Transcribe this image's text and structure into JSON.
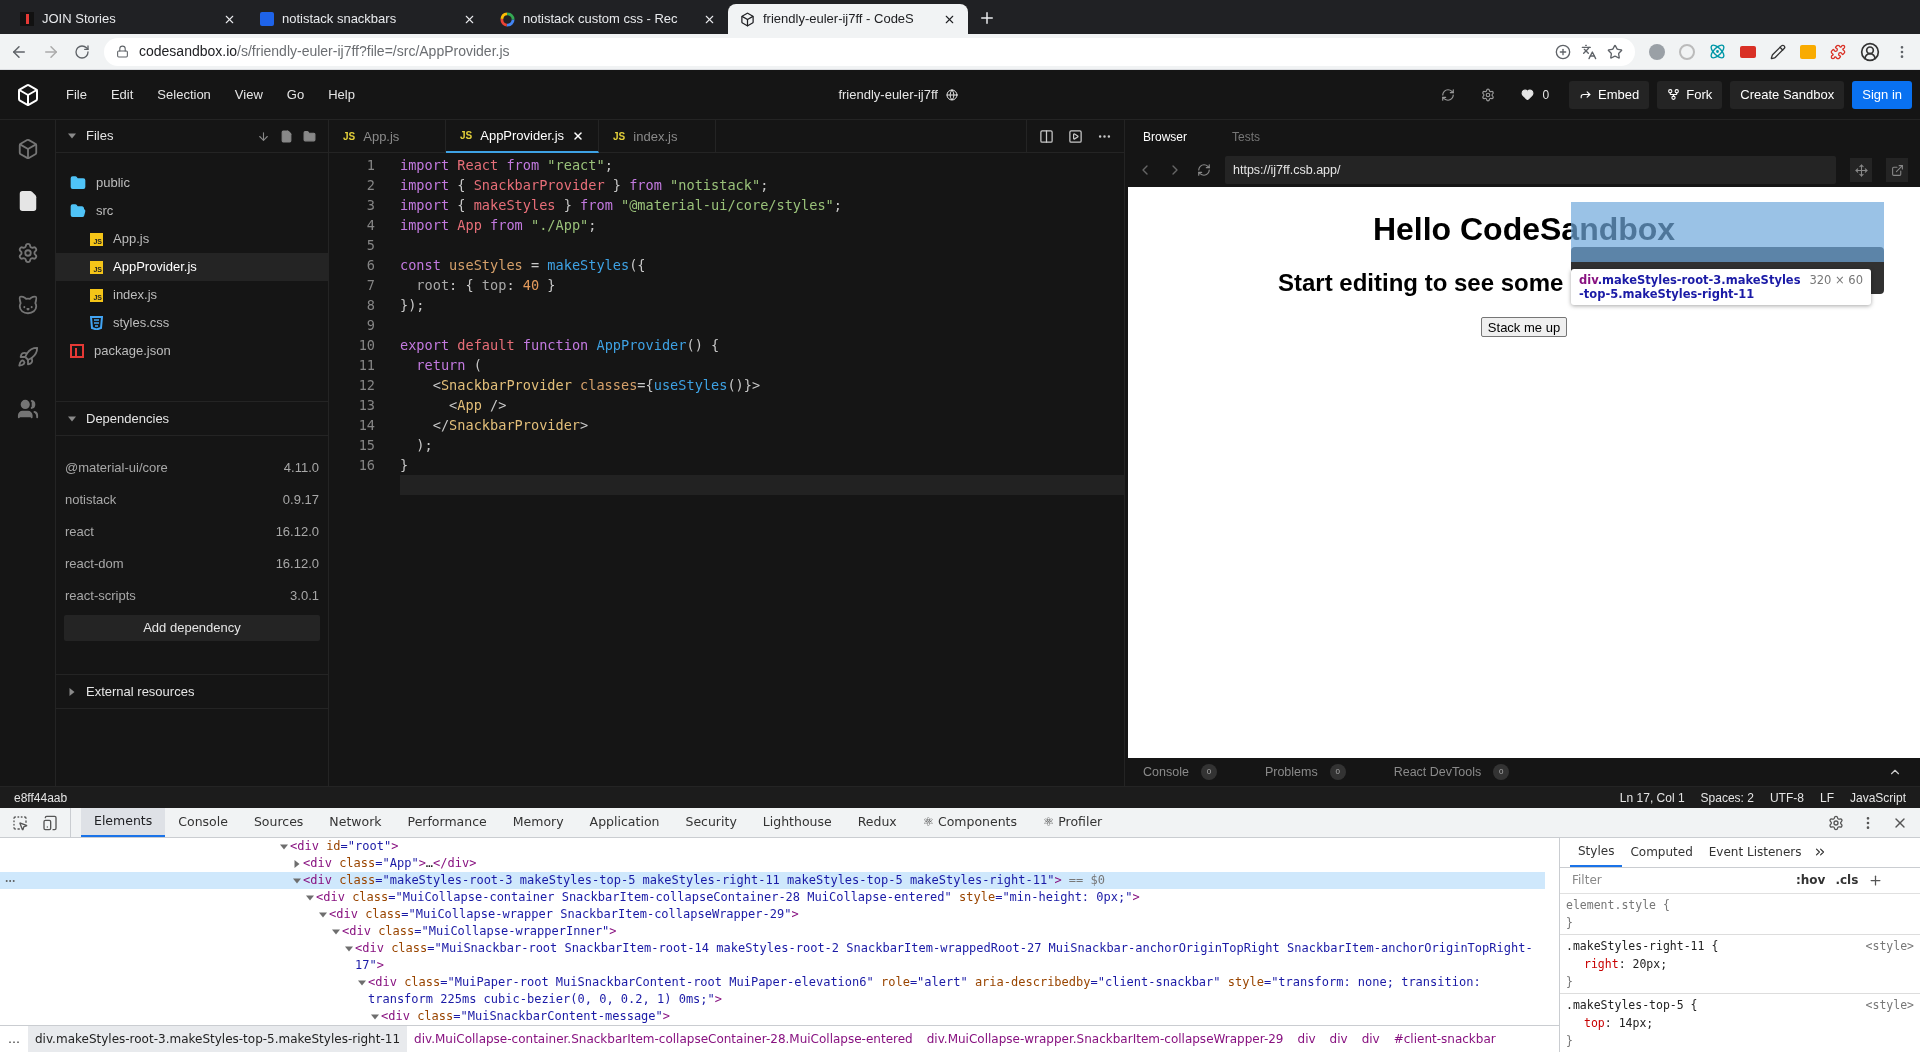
{
  "browser_tabs": [
    {
      "title": "JOIN Stories",
      "selected": false,
      "kind": "bar"
    },
    {
      "title": "notistack snackbars",
      "selected": false,
      "kind": "square"
    },
    {
      "title": "notistack custom css - Rec",
      "selected": false,
      "kind": "ring"
    },
    {
      "title": "friendly-euler-ij7ff - CodeS",
      "selected": true,
      "kind": "cube"
    }
  ],
  "address_bar": {
    "host": "codesandbox.io",
    "path": "/s/friendly-euler-ij7ff?file=/src/AppProvider.js"
  },
  "app_header": {
    "menu": [
      "File",
      "Edit",
      "Selection",
      "View",
      "Go",
      "Help"
    ],
    "title": "friendly-euler-ij7ff",
    "likes": "0",
    "buttons": [
      {
        "label": "Embed",
        "kind": "embed"
      },
      {
        "label": "Fork",
        "kind": "fork"
      },
      {
        "label": "Create Sandbox",
        "kind": "plain"
      },
      {
        "label": "Sign in",
        "kind": "primary"
      }
    ]
  },
  "activity_bar": [
    {
      "kind": "cube",
      "selected": false
    },
    {
      "kind": "files",
      "selected": true
    },
    {
      "kind": "settings",
      "selected": false
    },
    {
      "kind": "cat",
      "selected": false
    },
    {
      "kind": "deploy",
      "selected": false
    },
    {
      "kind": "team",
      "selected": false
    }
  ],
  "files_panel": {
    "title": "Files",
    "expanded": true,
    "tree": [
      {
        "name": "public",
        "kind": "folder",
        "expanded": false,
        "selected": false
      },
      {
        "name": "src",
        "kind": "folder",
        "expanded": true,
        "selected": false,
        "children": [
          {
            "name": "App.js",
            "kind": "js",
            "badge": "JS",
            "selected": false
          },
          {
            "name": "AppProvider.js",
            "kind": "js",
            "badge": "JS",
            "selected": true
          },
          {
            "name": "index.js",
            "kind": "js",
            "badge": "JS",
            "selected": false
          },
          {
            "name": "styles.css",
            "kind": "css",
            "selected": false
          }
        ]
      },
      {
        "name": "package.json",
        "kind": "npm",
        "selected": false
      }
    ]
  },
  "dependencies": {
    "title": "Dependencies",
    "expanded": true,
    "items": [
      {
        "name": "@material-ui/core",
        "version": "4.11.0"
      },
      {
        "name": "notistack",
        "version": "0.9.17"
      },
      {
        "name": "react",
        "version": "16.12.0"
      },
      {
        "name": "react-dom",
        "version": "16.12.0"
      },
      {
        "name": "react-scripts",
        "version": "3.0.1"
      }
    ],
    "add_button": "Add dependency"
  },
  "external_resources": {
    "title": "External resources",
    "expanded": false
  },
  "editor": {
    "tabs": [
      {
        "name": "App.js",
        "badge": "JS",
        "selected": false
      },
      {
        "name": "AppProvider.js",
        "badge": "JS",
        "selected": true
      },
      {
        "name": "index.js",
        "badge": "JS",
        "selected": false
      }
    ],
    "lines": [
      {
        "num": "1",
        "tokens": [
          {
            "kind": "kw",
            "text": "import "
          },
          {
            "kind": "var",
            "text": "React "
          },
          {
            "kind": "kw",
            "text": "from "
          },
          {
            "kind": "str",
            "text": "\"react\""
          },
          {
            "kind": "p",
            "text": ";"
          }
        ]
      },
      {
        "num": "2",
        "tokens": [
          {
            "kind": "kw",
            "text": "import "
          },
          {
            "kind": "p",
            "text": "{ "
          },
          {
            "kind": "var",
            "text": "SnackbarProvider "
          },
          {
            "kind": "p",
            "text": "} "
          },
          {
            "kind": "kw",
            "text": "from "
          },
          {
            "kind": "str",
            "text": "\"notistack\""
          },
          {
            "kind": "p",
            "text": ";"
          }
        ]
      },
      {
        "num": "3",
        "tokens": [
          {
            "kind": "kw",
            "text": "import "
          },
          {
            "kind": "p",
            "text": "{ "
          },
          {
            "kind": "var",
            "text": "makeStyles "
          },
          {
            "kind": "p",
            "text": "} "
          },
          {
            "kind": "kw",
            "text": "from "
          },
          {
            "kind": "str",
            "text": "\"@material-ui/core/styles\""
          },
          {
            "kind": "p",
            "text": ";"
          }
        ]
      },
      {
        "num": "4",
        "tokens": [
          {
            "kind": "kw",
            "text": "import "
          },
          {
            "kind": "var",
            "text": "App "
          },
          {
            "kind": "kw",
            "text": "from "
          },
          {
            "kind": "str",
            "text": "\"./App\""
          },
          {
            "kind": "p",
            "text": ";"
          }
        ]
      },
      {
        "num": "5"
      },
      {
        "num": "6",
        "tokens": [
          {
            "kind": "kw",
            "text": "const "
          },
          {
            "kind": "def",
            "text": "useStyles "
          },
          {
            "kind": "p",
            "text": "= "
          },
          {
            "kind": "fn",
            "text": "makeStyles"
          },
          {
            "kind": "p",
            "text": "({"
          }
        ]
      },
      {
        "num": "7",
        "tokens": [
          {
            "kind": "prop",
            "text": "  root"
          },
          {
            "kind": "p",
            "text": ": { "
          },
          {
            "kind": "prop",
            "text": "top"
          },
          {
            "kind": "p",
            "text": ": "
          },
          {
            "kind": "num",
            "text": "40"
          },
          {
            "kind": "p",
            "text": " }"
          }
        ]
      },
      {
        "num": "8",
        "tokens": [
          {
            "kind": "p",
            "text": "});"
          }
        ]
      },
      {
        "num": "9"
      },
      {
        "num": "10",
        "tokens": [
          {
            "kind": "kw",
            "text": "export "
          },
          {
            "kind": "var",
            "text": "default "
          },
          {
            "kind": "kw",
            "text": "function "
          },
          {
            "kind": "fn",
            "text": "AppProvider"
          },
          {
            "kind": "p",
            "text": "() {"
          }
        ]
      },
      {
        "num": "11",
        "tokens": [
          {
            "kind": "kw",
            "text": "  return"
          },
          {
            "kind": "p",
            "text": " ("
          }
        ]
      },
      {
        "num": "12",
        "tokens": [
          {
            "kind": "p",
            "text": "    <"
          },
          {
            "kind": "tag",
            "text": "SnackbarProvider "
          },
          {
            "kind": "def",
            "text": "classes"
          },
          {
            "kind": "p",
            "text": "={"
          },
          {
            "kind": "fn",
            "text": "useStyles"
          },
          {
            "kind": "p",
            "text": "()}>"
          }
        ]
      },
      {
        "num": "13",
        "tokens": [
          {
            "kind": "p",
            "text": "      <"
          },
          {
            "kind": "tag",
            "text": "App"
          },
          {
            "kind": "p",
            "text": " />"
          }
        ]
      },
      {
        "num": "14",
        "tokens": [
          {
            "kind": "p",
            "text": "    </"
          },
          {
            "kind": "tag",
            "text": "SnackbarProvider"
          },
          {
            "kind": "p",
            "text": ">"
          }
        ]
      },
      {
        "num": "15",
        "tokens": [
          {
            "kind": "p",
            "text": "  );"
          }
        ]
      },
      {
        "num": "16",
        "tokens": [
          {
            "kind": "p",
            "text": "}"
          }
        ]
      }
    ]
  },
  "preview": {
    "tabs": [
      {
        "label": "Browser",
        "selected": true
      },
      {
        "label": "Tests",
        "selected": false
      }
    ],
    "url": "https://ij7ff.csb.app/",
    "page": {
      "heading": "Hello CodeSandbox",
      "subheading": "Start editing to see some",
      "button": "Stack me up"
    },
    "inspect_tooltip": {
      "tag": "div",
      "classes": ".makeStyles-root-3.makeStyles-top-5.makeStyles-right-11",
      "size": "320 × 60"
    },
    "panel_tabs": [
      {
        "label": "Console",
        "count": "0"
      },
      {
        "label": "Problems",
        "count": "0"
      },
      {
        "label": "React DevTools",
        "count": "0"
      }
    ]
  },
  "status_bar": {
    "commit": "e8ff44aab",
    "items": [
      "Ln 17, Col 1",
      "Spaces: 2",
      "UTF-8",
      "LF",
      "JavaScript"
    ]
  },
  "devtools": {
    "tabs": [
      {
        "label": "Elements",
        "selected": true
      },
      {
        "label": "Console",
        "selected": false
      },
      {
        "label": "Sources",
        "selected": false
      },
      {
        "label": "Network",
        "selected": false
      },
      {
        "label": "Performance",
        "selected": false
      },
      {
        "label": "Memory",
        "selected": false
      },
      {
        "label": "Application",
        "selected": false
      },
      {
        "label": "Security",
        "selected": false
      },
      {
        "label": "Lighthouse",
        "selected": false
      },
      {
        "label": "Redux",
        "selected": false
      },
      {
        "label": "⚛ Components",
        "selected": false
      },
      {
        "label": "⚛ Profiler",
        "selected": false
      }
    ],
    "dom_tree": [
      {
        "expanded": true,
        "selected": false,
        "line": [
          {
            "kind": "tag",
            "text": "<div"
          },
          {
            "kind": "attr",
            "text": " id"
          },
          {
            "kind": "val",
            "text": "=\"root\""
          },
          {
            "kind": "tag",
            "text": ">"
          }
        ],
        "children": [
          {
            "expanded": false,
            "selected": false,
            "line": [
              {
                "kind": "tag",
                "text": "<div"
              },
              {
                "kind": "attr",
                "text": " class"
              },
              {
                "kind": "val",
                "text": "=\"App\""
              },
              {
                "kind": "tag",
                "text": ">"
              },
              {
                "kind": "text",
                "text": "…"
              },
              {
                "kind": "tag",
                "text": "</div>"
              }
            ]
          },
          {
            "expanded": true,
            "selected": true,
            "line": [
              {
                "kind": "tag",
                "text": "<div"
              },
              {
                "kind": "attr",
                "text": " class"
              },
              {
                "kind": "val",
                "text": "=\"makeStyles-root-3 makeStyles-top-5 makeStyles-right-11 makeStyles-top-5 makeStyles-right-11\""
              },
              {
                "kind": "tag",
                "text": ">"
              },
              {
                "kind": "dim",
                "text": " == $0"
              }
            ],
            "children": [
              {
                "expanded": true,
                "selected": false,
                "line": [
                  {
                    "kind": "tag",
                    "text": "<div"
                  },
                  {
                    "kind": "attr",
                    "text": " class"
                  },
                  {
                    "kind": "val",
                    "text": "=\"MuiCollapse-container SnackbarItem-collapseContainer-28 MuiCollapse-entered\""
                  },
                  {
                    "kind": "attr",
                    "text": " style"
                  },
                  {
                    "kind": "val",
                    "text": "=\"min-height: 0px;\""
                  },
                  {
                    "kind": "tag",
                    "text": ">"
                  }
                ],
                "children": [
                  {
                    "expanded": true,
                    "selected": false,
                    "line": [
                      {
                        "kind": "tag",
                        "text": "<div"
                      },
                      {
                        "kind": "attr",
                        "text": " class"
                      },
                      {
                        "kind": "val",
                        "text": "=\"MuiCollapse-wrapper SnackbarItem-collapseWrapper-29\""
                      },
                      {
                        "kind": "tag",
                        "text": ">"
                      }
                    ],
                    "children": [
                      {
                        "expanded": true,
                        "selected": false,
                        "line": [
                          {
                            "kind": "tag",
                            "text": "<div"
                          },
                          {
                            "kind": "attr",
                            "text": " class"
                          },
                          {
                            "kind": "val",
                            "text": "=\"MuiCollapse-wrapperInner\""
                          },
                          {
                            "kind": "tag",
                            "text": ">"
                          }
                        ],
                        "children": [
                          {
                            "expanded": true,
                            "selected": false,
                            "line": [
                              {
                                "kind": "tag",
                                "text": "<div"
                              },
                              {
                                "kind": "attr",
                                "text": " class"
                              },
                              {
                                "kind": "val",
                                "text": "=\"MuiSnackbar-root SnackbarItem-root-14 makeStyles-root-2 SnackbarItem-wrappedRoot-27 MuiSnackbar-anchorOriginTopRight SnackbarItem-anchorOriginTopRight-17\""
                              },
                              {
                                "kind": "tag",
                                "text": ">"
                              }
                            ],
                            "children": [
                              {
                                "expanded": true,
                                "selected": false,
                                "line": [
                                  {
                                    "kind": "tag",
                                    "text": "<div"
                                  },
                                  {
                                    "kind": "attr",
                                    "text": " class"
                                  },
                                  {
                                    "kind": "val",
                                    "text": "=\"MuiPaper-root MuiSnackbarContent-root MuiPaper-elevation6\""
                                  },
                                  {
                                    "kind": "attr",
                                    "text": " role"
                                  },
                                  {
                                    "kind": "val",
                                    "text": "=\"alert\""
                                  },
                                  {
                                    "kind": "attr",
                                    "text": " aria-describedby"
                                  },
                                  {
                                    "kind": "val",
                                    "text": "=\"client-snackbar\""
                                  },
                                  {
                                    "kind": "attr",
                                    "text": " style"
                                  },
                                  {
                                    "kind": "val",
                                    "text": "=\"transform: none; transition: transform 225ms cubic-bezier(0, 0, 0.2, 1) 0ms;\""
                                  },
                                  {
                                    "kind": "tag",
                                    "text": ">"
                                  }
                                ],
                                "children": [
                                  {
                                    "expanded": true,
                                    "selected": false,
                                    "line": [
                                      {
                                        "kind": "tag",
                                        "text": "<div"
                                      },
                                      {
                                        "kind": "attr",
                                        "text": " class"
                                      },
                                      {
                                        "kind": "val",
                                        "text": "=\"MuiSnackbarContent-message\""
                                      },
                                      {
                                        "kind": "tag",
                                        "text": ">"
                                      }
                                    ]
                                  }
                                ]
                              }
                            ]
                          }
                        ]
                      }
                    ]
                  }
                ]
              }
            ]
          }
        ]
      }
    ],
    "breadcrumbs": {
      "more": "…",
      "items": [
        {
          "text": "div.makeStyles-root-3.makeStyles-top-5.makeStyles-right-11",
          "selected": true
        },
        {
          "text": "div.MuiCollapse-container.SnackbarItem-collapseContainer-28.MuiCollapse-entered",
          "selected": false
        },
        {
          "text": "div.MuiCollapse-wrapper.SnackbarItem-collapseWrapper-29",
          "selected": false
        },
        {
          "text": "div",
          "selected": false
        },
        {
          "text": "div",
          "selected": false
        },
        {
          "text": "div",
          "selected": false
        },
        {
          "text": "#client-snackbar",
          "selected": false
        }
      ]
    },
    "styles": {
      "tabs": [
        {
          "label": "Styles",
          "selected": true
        },
        {
          "label": "Computed",
          "selected": false
        },
        {
          "label": "Event Listeners",
          "selected": false
        }
      ],
      "filter_placeholder": "Filter",
      "hov": ":hov",
      "cls": ".cls",
      "rules": [
        {
          "kind": "inline",
          "selector": "element.style {",
          "close": "}"
        },
        {
          "kind": "rule",
          "selector": ".makeStyles-right-11 {",
          "source": "<style>",
          "decls": [
            {
              "name": "right",
              "value": ": 20px;"
            }
          ],
          "close": "}"
        },
        {
          "kind": "rule",
          "selector": ".makeStyles-top-5 {",
          "source": "<style>",
          "decls": [
            {
              "name": "top",
              "value": ": 14px;"
            }
          ],
          "close": "}"
        }
      ]
    }
  }
}
